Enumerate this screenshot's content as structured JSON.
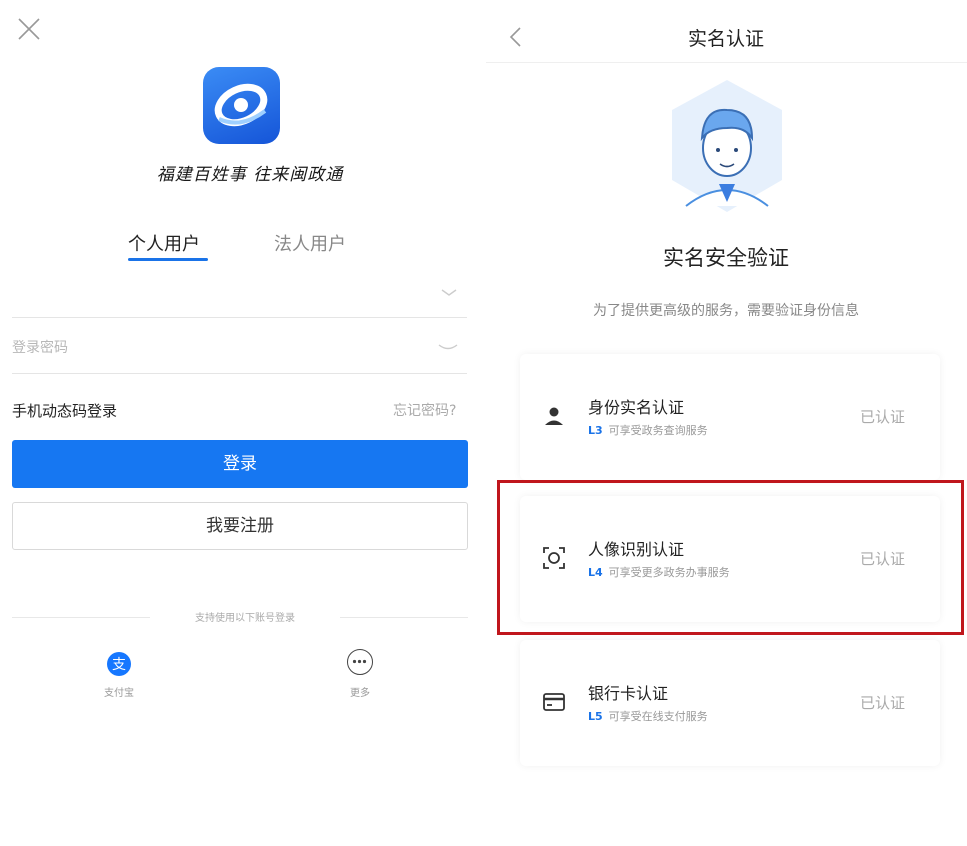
{
  "login": {
    "slogan": "福建百姓事 往来闽政通",
    "tabs": [
      {
        "label": "个人用户",
        "active": true
      },
      {
        "label": "法人用户",
        "active": false
      }
    ],
    "password_placeholder": "登录密码",
    "sms_login_label": "手机动态码登录",
    "forgot_password_label": "忘记密码?",
    "login_button_label": "登录",
    "register_button_label": "我要注册",
    "support_text": "支持使用以下账号登录",
    "third_party": [
      {
        "label": "支付宝",
        "icon": "alipay-icon"
      },
      {
        "label": "更多",
        "icon": "more-icon"
      }
    ],
    "accent_color": "#1677f2"
  },
  "verify": {
    "nav_title": "实名认证",
    "title": "实名安全验证",
    "subtitle": "为了提供更高级的服务，需要验证身份信息",
    "cards": [
      {
        "title": "身份实名认证",
        "level": "L3",
        "desc": "可享受政务查询服务",
        "status": "已认证",
        "icon": "person-icon"
      },
      {
        "title": "人像识别认证",
        "level": "L4",
        "desc": "可享受更多政务办事服务",
        "status": "已认证",
        "icon": "face-scan-icon"
      },
      {
        "title": "银行卡认证",
        "level": "L5",
        "desc": "可享受在线支付服务",
        "status": "已认证",
        "icon": "bank-card-icon"
      }
    ],
    "highlight_color": "#c0161c"
  }
}
